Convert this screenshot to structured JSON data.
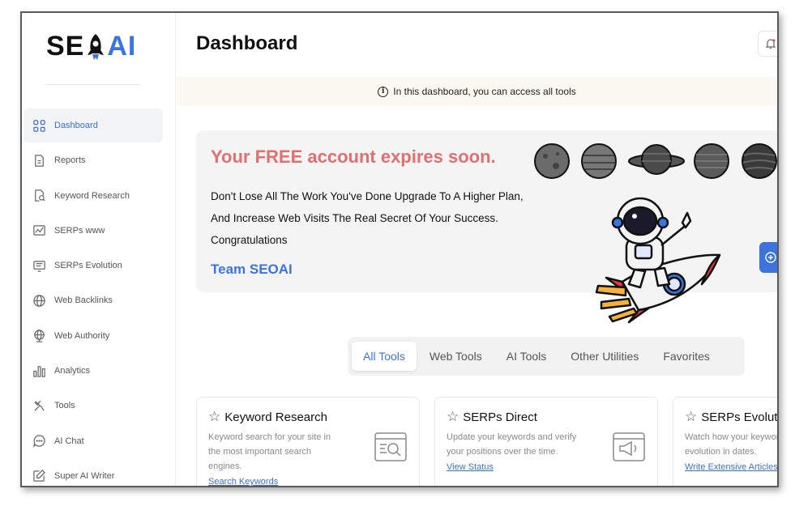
{
  "logo": {
    "text_left": "SE",
    "text_right": "AI"
  },
  "sidebar": {
    "items": [
      {
        "label": "Dashboard",
        "icon": "grid-icon",
        "active": true
      },
      {
        "label": "Reports",
        "icon": "document-icon"
      },
      {
        "label": "Keyword Research",
        "icon": "file-search-icon"
      },
      {
        "label": "SERPs www",
        "icon": "chart-image-icon"
      },
      {
        "label": "SERPs Evolution",
        "icon": "monitor-list-icon"
      },
      {
        "label": "Web Backlinks",
        "icon": "globe-icon"
      },
      {
        "label": "Web Authority",
        "icon": "globe-network-icon"
      },
      {
        "label": "Analytics",
        "icon": "bar-chart-icon"
      },
      {
        "label": "Tools",
        "icon": "tools-icon"
      },
      {
        "label": "AI Chat",
        "icon": "chat-bubble-icon"
      },
      {
        "label": "Super AI Writer",
        "icon": "edit-pen-icon"
      }
    ]
  },
  "header": {
    "title": "Dashboard"
  },
  "notice": {
    "text": "In this dashboard, you can access all tools"
  },
  "banner": {
    "title": "Your FREE account expires soon.",
    "text": "Don't Lose All The Work You've Done Upgrade To A Higher Plan, And Increase Web Visits The Real Secret Of Your Success. Congratulations",
    "signature": "Team SEOAI"
  },
  "tabs": [
    {
      "label": "All Tools",
      "active": true
    },
    {
      "label": "Web Tools"
    },
    {
      "label": "AI Tools"
    },
    {
      "label": "Other Utilities"
    },
    {
      "label": "Favorites"
    }
  ],
  "cards": [
    {
      "title": "Keyword Research",
      "desc": "Keyword search for your site in the most important search engines.",
      "link": "Search Keywords",
      "icon": "browser-search-icon"
    },
    {
      "title": "SERPs Direct",
      "desc": "Update your keywords and verify your positions over the time.",
      "link": "View Status",
      "icon": "browser-megaphone-icon"
    },
    {
      "title": "SERPs Evolution",
      "desc": "Watch how your keywords evolution in dates.",
      "link": "Write Extensive Articles",
      "icon": "browser-chart-icon"
    }
  ],
  "colors": {
    "accent": "#3d73e0",
    "warning_title": "#e07070",
    "notice_bg": "#fbf8f1"
  }
}
